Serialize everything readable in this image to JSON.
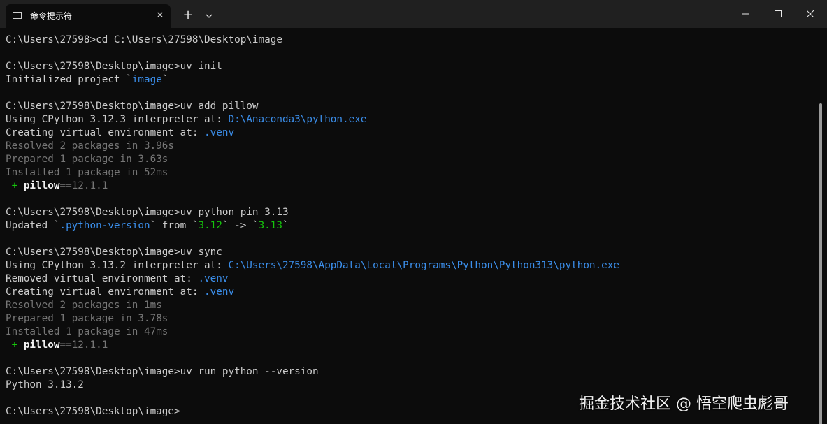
{
  "tab": {
    "title": "命令提示符",
    "icon": "terminal-icon",
    "close_icon": "close-icon"
  },
  "titlebar": {
    "new_tab_label": "+",
    "dropdown_icon": "chevron-down-icon",
    "minimize_icon": "minimize-icon",
    "maximize_icon": "maximize-icon",
    "close_icon": "close-icon"
  },
  "terminal": {
    "lines": [
      [
        {
          "t": "C:\\Users\\27598>cd C:\\Users\\27598\\Desktop\\image",
          "c": "plain"
        }
      ],
      [],
      [
        {
          "t": "C:\\Users\\27598\\Desktop\\image>uv init",
          "c": "plain"
        }
      ],
      [
        {
          "t": "Initialized project `",
          "c": "plain"
        },
        {
          "t": "image",
          "c": "blue"
        },
        {
          "t": "`",
          "c": "plain"
        }
      ],
      [],
      [
        {
          "t": "C:\\Users\\27598\\Desktop\\image>uv add pillow",
          "c": "plain"
        }
      ],
      [
        {
          "t": "Using CPython 3.12.3 interpreter at: ",
          "c": "plain"
        },
        {
          "t": "D:\\Anaconda3\\python.exe",
          "c": "blue"
        }
      ],
      [
        {
          "t": "Creating virtual environment at: ",
          "c": "plain"
        },
        {
          "t": ".venv",
          "c": "blue"
        }
      ],
      [
        {
          "t": "Resolved ",
          "c": "dim"
        },
        {
          "t": "2 packages",
          "c": "dim"
        },
        {
          "t": " in 3.96s",
          "c": "dim"
        }
      ],
      [
        {
          "t": "Prepared ",
          "c": "dim"
        },
        {
          "t": "1 package",
          "c": "dim"
        },
        {
          "t": " in 3.63s",
          "c": "dim"
        }
      ],
      [
        {
          "t": "Installed ",
          "c": "dim"
        },
        {
          "t": "1 package",
          "c": "dim"
        },
        {
          "t": " in 52ms",
          "c": "dim"
        }
      ],
      [
        {
          "t": " + ",
          "c": "green"
        },
        {
          "t": "pillow",
          "c": "white"
        },
        {
          "t": "==12.1.1",
          "c": "dim"
        }
      ],
      [],
      [
        {
          "t": "C:\\Users\\27598\\Desktop\\image>uv python pin 3.13",
          "c": "plain"
        }
      ],
      [
        {
          "t": "Updated `",
          "c": "plain"
        },
        {
          "t": ".python-version",
          "c": "blue"
        },
        {
          "t": "` from `",
          "c": "plain"
        },
        {
          "t": "3.12",
          "c": "green"
        },
        {
          "t": "` -> `",
          "c": "plain"
        },
        {
          "t": "3.13",
          "c": "green"
        },
        {
          "t": "`",
          "c": "plain"
        }
      ],
      [],
      [
        {
          "t": "C:\\Users\\27598\\Desktop\\image>uv sync",
          "c": "plain"
        }
      ],
      [
        {
          "t": "Using CPython 3.13.2 interpreter at: ",
          "c": "plain"
        },
        {
          "t": "C:\\Users\\27598\\AppData\\Local\\Programs\\Python\\Python313\\python.exe",
          "c": "blue"
        }
      ],
      [
        {
          "t": "Removed virtual environment at: ",
          "c": "plain"
        },
        {
          "t": ".venv",
          "c": "blue"
        }
      ],
      [
        {
          "t": "Creating virtual environment at: ",
          "c": "plain"
        },
        {
          "t": ".venv",
          "c": "blue"
        }
      ],
      [
        {
          "t": "Resolved ",
          "c": "dim"
        },
        {
          "t": "2 packages",
          "c": "dim"
        },
        {
          "t": " in 1ms",
          "c": "dim"
        }
      ],
      [
        {
          "t": "Prepared ",
          "c": "dim"
        },
        {
          "t": "1 package",
          "c": "dim"
        },
        {
          "t": " in 3.78s",
          "c": "dim"
        }
      ],
      [
        {
          "t": "Installed ",
          "c": "dim"
        },
        {
          "t": "1 package",
          "c": "dim"
        },
        {
          "t": " in 47ms",
          "c": "dim"
        }
      ],
      [
        {
          "t": " + ",
          "c": "green"
        },
        {
          "t": "pillow",
          "c": "white"
        },
        {
          "t": "==12.1.1",
          "c": "dim"
        }
      ],
      [],
      [
        {
          "t": "C:\\Users\\27598\\Desktop\\image>uv run python --version",
          "c": "plain"
        }
      ],
      [
        {
          "t": "Python 3.13.2",
          "c": "plain"
        }
      ],
      [],
      [
        {
          "t": "C:\\Users\\27598\\Desktop\\image>",
          "c": "plain"
        }
      ]
    ]
  },
  "watermark": "掘金技术社区 @ 悟空爬虫彪哥",
  "colors": {
    "background": "#0c0c0c",
    "titlebar": "#202020",
    "text": "#cccccc",
    "dim": "#767676",
    "blue": "#3b8eea",
    "green": "#16c60c"
  }
}
